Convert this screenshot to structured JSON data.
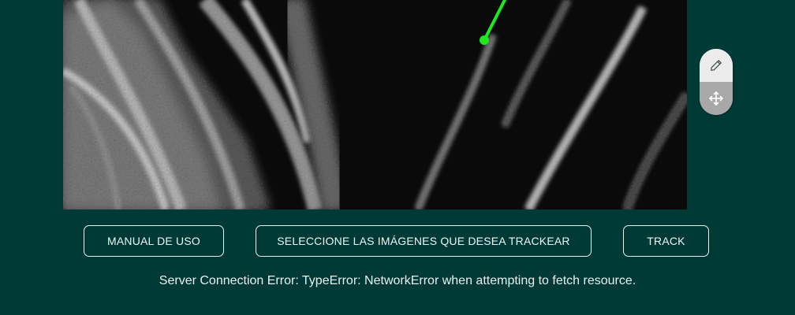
{
  "viewer": {
    "image": "grayscale microscopy image of filament structures",
    "track_color": "#1ee81e",
    "tools": [
      {
        "name": "pencil-icon",
        "tooltip": ""
      },
      {
        "name": "move-icon",
        "tooltip": ""
      }
    ]
  },
  "actions": {
    "manual_label": "MANUAL DE USO",
    "select_label": "SELECCIONE LAS IMÁGENES QUE DESEA TRACKEAR",
    "track_label": "TRACK"
  },
  "status": {
    "error_message": "Server Connection Error: TypeError: NetworkError when attempting to fetch resource."
  },
  "colors": {
    "background": "#003a36",
    "button_border": "#e6f2ef",
    "text": "#eef6f4"
  }
}
